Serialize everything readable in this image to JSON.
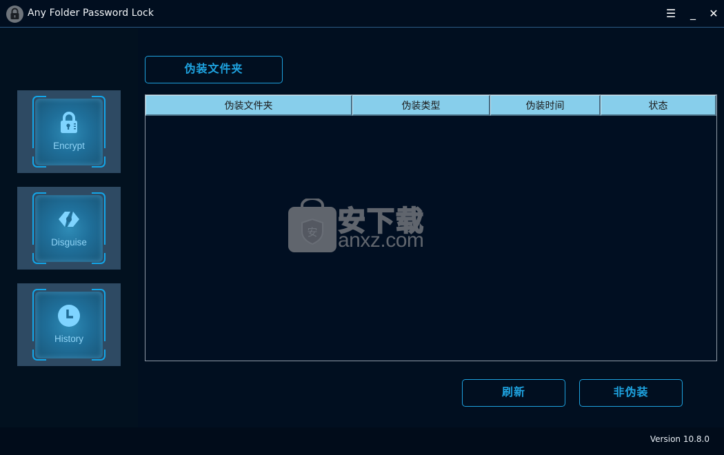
{
  "window": {
    "title": "Any Folder Password Lock",
    "controls": {
      "menu": "☰",
      "minimize": "_",
      "close": "✕"
    }
  },
  "sidebar": {
    "items": [
      {
        "label": "Encrypt",
        "icon": "lock-icon"
      },
      {
        "label": "Disguise",
        "icon": "disguise-icon"
      },
      {
        "label": "History",
        "icon": "clock-icon"
      }
    ]
  },
  "main": {
    "tab_button": "伪装文件夹",
    "table": {
      "columns": [
        "伪装文件夹",
        "伪装类型",
        "伪装时间",
        "状态"
      ],
      "rows": []
    },
    "watermark": {
      "text": "安下载",
      "url": "anxz.com"
    },
    "buttons": {
      "refresh": "刷新",
      "undisguise": "非伪装"
    }
  },
  "footer": {
    "version": "Version 10.8.0"
  },
  "colors": {
    "accent": "#1ea3e0",
    "header_bg": "#87ceeb",
    "background": "#010f20",
    "card_bg": "#2e4a63",
    "icon": "#7fd4ff"
  }
}
